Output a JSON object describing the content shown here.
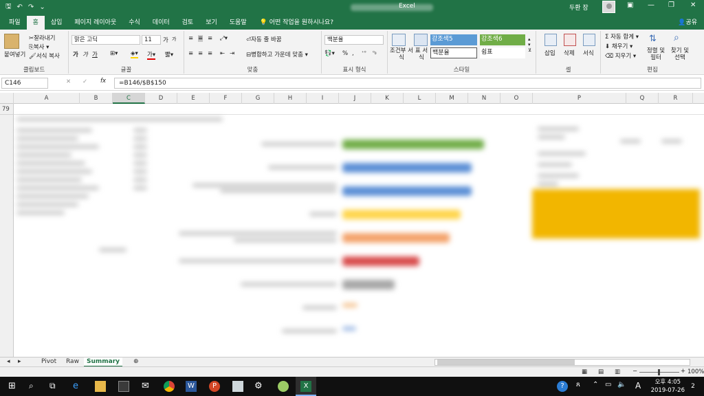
{
  "window": {
    "app_name": "Excel",
    "user": "두환 장",
    "share": "공유"
  },
  "tabs": [
    "파일",
    "홈",
    "삽입",
    "페이지 레이아웃",
    "수식",
    "데이터",
    "검토",
    "보기",
    "도움말"
  ],
  "tell_me": "어떤 작업을 원하시나요?",
  "ribbon": {
    "clipboard": {
      "paste": "붙여넣기",
      "cut": "잘라내기",
      "copy": "복사",
      "format_painter": "서식 복사",
      "label": "클립보드"
    },
    "font": {
      "name": "맑은 고딕",
      "size": "11",
      "label": "글꼴"
    },
    "alignment": {
      "wrap": "자동 줄 바꿈",
      "merge": "병합하고 가운데 맞춤",
      "label": "맞춤"
    },
    "number": {
      "format": "백분율",
      "label": "표시 형식"
    },
    "styles": {
      "conditional": "조건부 서식",
      "table": "표 서식",
      "accent5": "강조색5",
      "accent6": "강조색6",
      "percent": "백분율",
      "comma": "쉼표",
      "label": "스타일"
    },
    "cells": {
      "insert": "삽입",
      "delete": "삭제",
      "format": "서식",
      "label": "셀"
    },
    "editing": {
      "autosum": "자동 합계",
      "fill": "채우기",
      "clear": "지우기",
      "sort": "정렬 및 필터",
      "find": "찾기 및 선택",
      "label": "편집"
    }
  },
  "formula_bar": {
    "name_box": "C146",
    "formula": "=B146/$B$150"
  },
  "columns": [
    "A",
    "B",
    "C",
    "D",
    "E",
    "F",
    "G",
    "H",
    "I",
    "J",
    "K",
    "L",
    "M",
    "N",
    "O",
    "P",
    "Q",
    "R"
  ],
  "selected_column": "C",
  "visible_rows": [
    "79"
  ],
  "sheet_tabs": [
    "Pivot",
    "Raw",
    "Summary"
  ],
  "active_sheet": "Summary",
  "status": {
    "zoom": "100%"
  },
  "taskbar": {
    "time": "오후 4:05",
    "date": "2019-07-26",
    "notifications": "2"
  },
  "colors": {
    "excel_green": "#217346",
    "bar_green": "#70ad47",
    "bar_blue": "#5b8fd6",
    "bar_yellow": "#ffd54a",
    "bar_orange": "#f4a26a",
    "bar_red": "#d84b4b",
    "bar_gray": "#a6a6a6",
    "highlight_gold": "#f2b600"
  }
}
